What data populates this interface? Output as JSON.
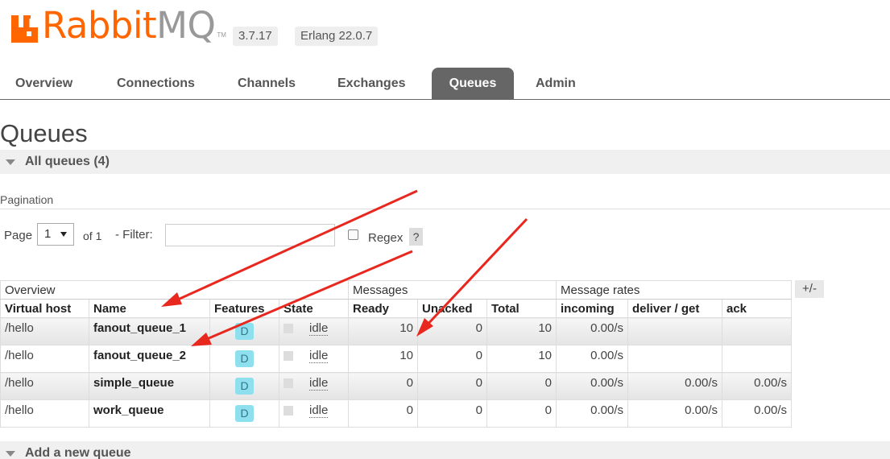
{
  "header": {
    "logo_text_primary": "Rabbit",
    "logo_text_secondary": "MQ",
    "logo_tm": "TM",
    "rabbit_version": "3.7.17",
    "erlang_version": "Erlang 22.0.7",
    "brand_color": "#ff6600"
  },
  "tabs": [
    {
      "label": "Overview"
    },
    {
      "label": "Connections"
    },
    {
      "label": "Channels"
    },
    {
      "label": "Exchanges"
    },
    {
      "label": "Queues"
    },
    {
      "label": "Admin"
    }
  ],
  "active_tab": "Queues",
  "page": {
    "title": "Queues",
    "all_queues_label": "All queues (4)",
    "pagination_label": "Pagination",
    "page_label": "Page",
    "page_value": "1",
    "of_label": "of 1",
    "filter_label": "- Filter:",
    "filter_value": "",
    "regex_label": "Regex",
    "regex_checked": false,
    "regex_help": "?",
    "add_queue_label": "Add a new queue"
  },
  "table": {
    "groups": [
      "Overview",
      "Messages",
      "Message rates"
    ],
    "toggle_columns": "+/-",
    "columns": [
      "Virtual host",
      "Name",
      "Features",
      "State",
      "Ready",
      "Unacked",
      "Total",
      "incoming",
      "deliver / get",
      "ack"
    ],
    "rows": [
      {
        "vhost": "/hello",
        "name": "fanout_queue_1",
        "feature": "D",
        "state": "idle",
        "ready": "10",
        "unacked": "0",
        "total": "10",
        "incoming": "0.00/s",
        "deliver_get": "",
        "ack": ""
      },
      {
        "vhost": "/hello",
        "name": "fanout_queue_2",
        "feature": "D",
        "state": "idle",
        "ready": "10",
        "unacked": "0",
        "total": "10",
        "incoming": "0.00/s",
        "deliver_get": "",
        "ack": ""
      },
      {
        "vhost": "/hello",
        "name": "simple_queue",
        "feature": "D",
        "state": "idle",
        "ready": "0",
        "unacked": "0",
        "total": "0",
        "incoming": "0.00/s",
        "deliver_get": "0.00/s",
        "ack": "0.00/s"
      },
      {
        "vhost": "/hello",
        "name": "work_queue",
        "feature": "D",
        "state": "idle",
        "ready": "0",
        "unacked": "0",
        "total": "0",
        "incoming": "0.00/s",
        "deliver_get": "0.00/s",
        "ack": "0.00/s"
      }
    ]
  },
  "annotation": {
    "arrow_color": "#e8281f"
  }
}
